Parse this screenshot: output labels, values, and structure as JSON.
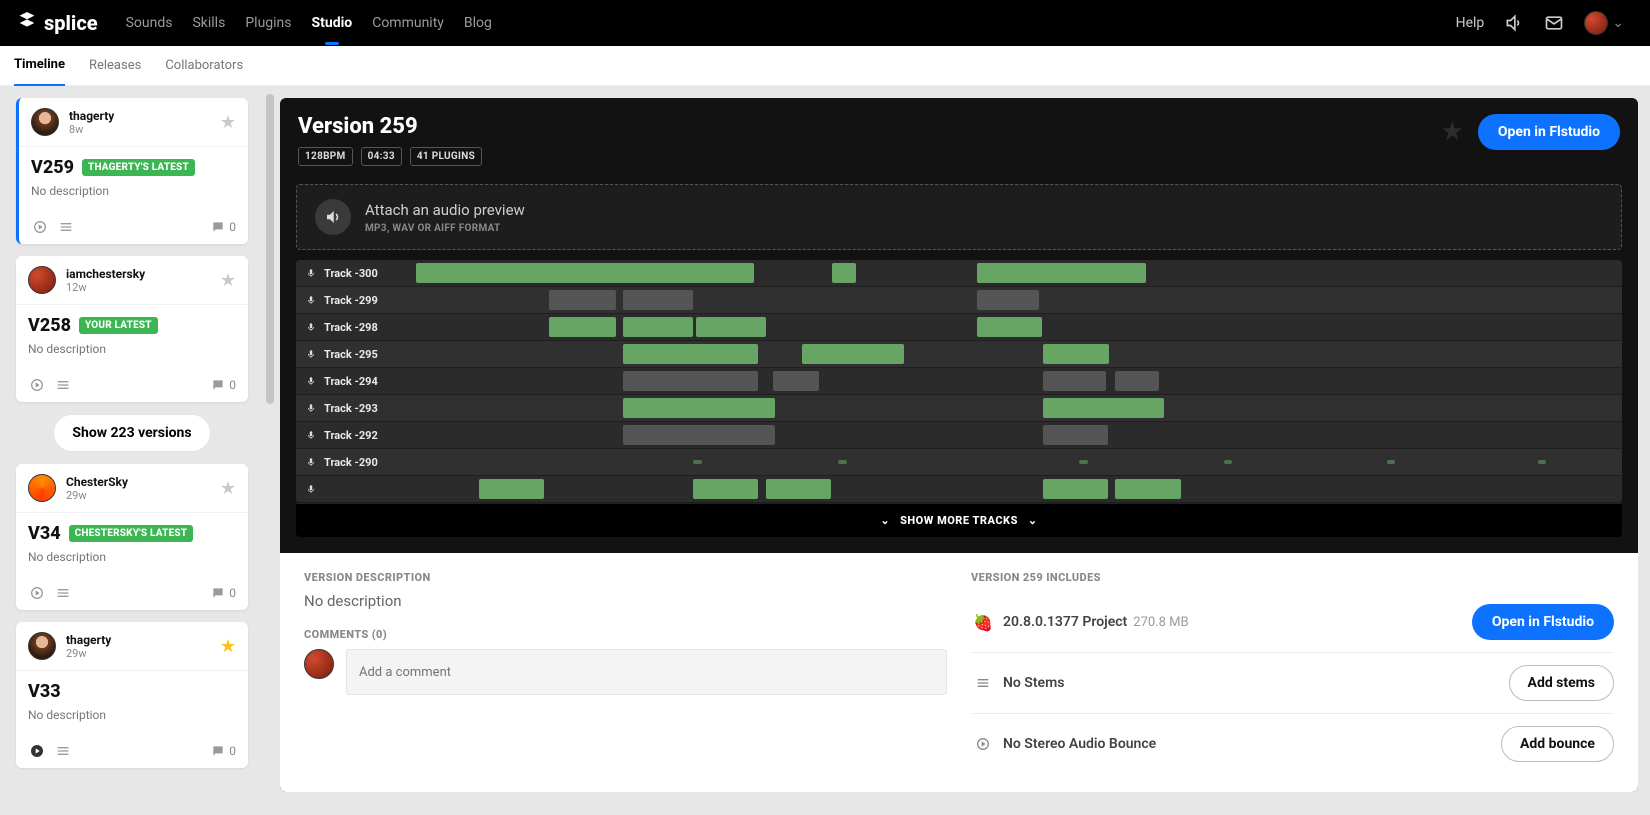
{
  "brand": "splice",
  "topnav": [
    "Sounds",
    "Skills",
    "Plugins",
    "Studio",
    "Community",
    "Blog"
  ],
  "topnav_active": "Studio",
  "help": "Help",
  "subnav": [
    "Timeline",
    "Releases",
    "Collaborators"
  ],
  "subnav_active": "Timeline",
  "sidebar": {
    "show_more": "Show 223 versions",
    "cards": [
      {
        "user": "thagerty",
        "age": "8w",
        "star": "gray",
        "avatar": "headshot",
        "version": "V259",
        "badge": "THAGERTY'S LATEST",
        "desc": "No description",
        "comments": "0",
        "selected": true,
        "play": "outline"
      },
      {
        "user": "iamchestersky",
        "age": "12w",
        "star": "gray",
        "avatar": "checker",
        "version": "V258",
        "badge": "YOUR LATEST",
        "desc": "No description",
        "comments": "0",
        "play": "outline"
      },
      {
        "user": "ChesterSky",
        "age": "29w",
        "star": "gray",
        "avatar": "orange",
        "version": "V34",
        "badge": "CHESTERSKY'S LATEST",
        "desc": "No description",
        "comments": "0",
        "play": "outline"
      },
      {
        "user": "thagerty",
        "age": "29w",
        "star": "gold",
        "avatar": "headshot",
        "version": "V33",
        "badge": "",
        "desc": "No description",
        "comments": "0",
        "play": "solid"
      }
    ]
  },
  "version": {
    "title": "Version 259",
    "pills": [
      "128BPM",
      "04:33",
      "41 PLUGINS"
    ],
    "open_btn": "Open in Flstudio",
    "attach": {
      "title": "Attach an audio preview",
      "sub": "MP3, WAV OR AIFF FORMAT"
    },
    "show_more_tracks": "SHOW MORE TRACKS",
    "tracks": [
      {
        "name": "Track -300",
        "clips": [
          {
            "t": "g",
            "l": 0,
            "w": 28
          },
          {
            "t": "g",
            "l": 34.5,
            "w": 2
          },
          {
            "t": "g",
            "l": 46.5,
            "w": 14
          }
        ]
      },
      {
        "name": "Track -299",
        "clips": [
          {
            "t": "gr",
            "l": 11,
            "w": 5.6
          },
          {
            "t": "gr",
            "l": 17.2,
            "w": 5.8
          },
          {
            "t": "gr",
            "l": 46.5,
            "w": 5.2
          }
        ]
      },
      {
        "name": "Track -298",
        "clips": [
          {
            "t": "g",
            "l": 11,
            "w": 5.6
          },
          {
            "t": "g",
            "l": 17.2,
            "w": 5.8
          },
          {
            "t": "g",
            "l": 23.2,
            "w": 5.8
          },
          {
            "t": "g",
            "l": 46.5,
            "w": 5.4
          }
        ]
      },
      {
        "name": "Track -295",
        "clips": [
          {
            "t": "g",
            "l": 17.2,
            "w": 11.2
          },
          {
            "t": "g",
            "l": 32,
            "w": 8.5
          },
          {
            "t": "g",
            "l": 52,
            "w": 5.5
          }
        ]
      },
      {
        "name": "Track -294",
        "clips": [
          {
            "t": "gr",
            "l": 17.2,
            "w": 11.2
          },
          {
            "t": "gr",
            "l": 29.6,
            "w": 3.8
          },
          {
            "t": "gr",
            "l": 52,
            "w": 5.2
          },
          {
            "t": "gr",
            "l": 58,
            "w": 3.6
          }
        ]
      },
      {
        "name": "Track -293",
        "clips": [
          {
            "t": "g",
            "l": 17.2,
            "w": 12.6
          },
          {
            "t": "g",
            "l": 52,
            "w": 10
          }
        ]
      },
      {
        "name": "Track -292",
        "clips": [
          {
            "t": "gr",
            "l": 17.2,
            "w": 12.6
          },
          {
            "t": "gr",
            "l": 52,
            "w": 5.4
          }
        ]
      },
      {
        "name": "Track -290",
        "clips": [
          {
            "t": "sl",
            "l": 23,
            "w": 0.7
          },
          {
            "t": "sl",
            "l": 35,
            "w": 0.7
          },
          {
            "t": "sl",
            "l": 55,
            "w": 0.7
          },
          {
            "t": "sl",
            "l": 67,
            "w": 0.7
          },
          {
            "t": "sl",
            "l": 80.5,
            "w": 0.7
          },
          {
            "t": "sl",
            "l": 93,
            "w": 0.7
          }
        ]
      },
      {
        "name": "",
        "clips": [
          {
            "t": "g",
            "l": 5.2,
            "w": 5.4
          },
          {
            "t": "g",
            "l": 23,
            "w": 5.4
          },
          {
            "t": "g",
            "l": 29,
            "w": 5.4
          },
          {
            "t": "g",
            "l": 52,
            "w": 5.4
          },
          {
            "t": "g",
            "l": 58,
            "w": 5.4
          }
        ]
      }
    ]
  },
  "bottom": {
    "desc_label": "VERSION DESCRIPTION",
    "desc_text": "No description",
    "comments_label": "COMMENTS (0)",
    "comment_placeholder": "Add a comment",
    "includes_label": "VERSION 259 INCLUDES",
    "rows": [
      {
        "icon": "fruit",
        "label": "20.8.0.1377 Project",
        "sub": "270.8 MB",
        "action": "Open in Flstudio",
        "primary": true
      },
      {
        "icon": "list",
        "label": "No Stems",
        "sub": "",
        "action": "Add stems",
        "primary": false
      },
      {
        "icon": "play",
        "label": "No Stereo Audio Bounce",
        "sub": "",
        "action": "Add bounce",
        "primary": false
      }
    ]
  }
}
